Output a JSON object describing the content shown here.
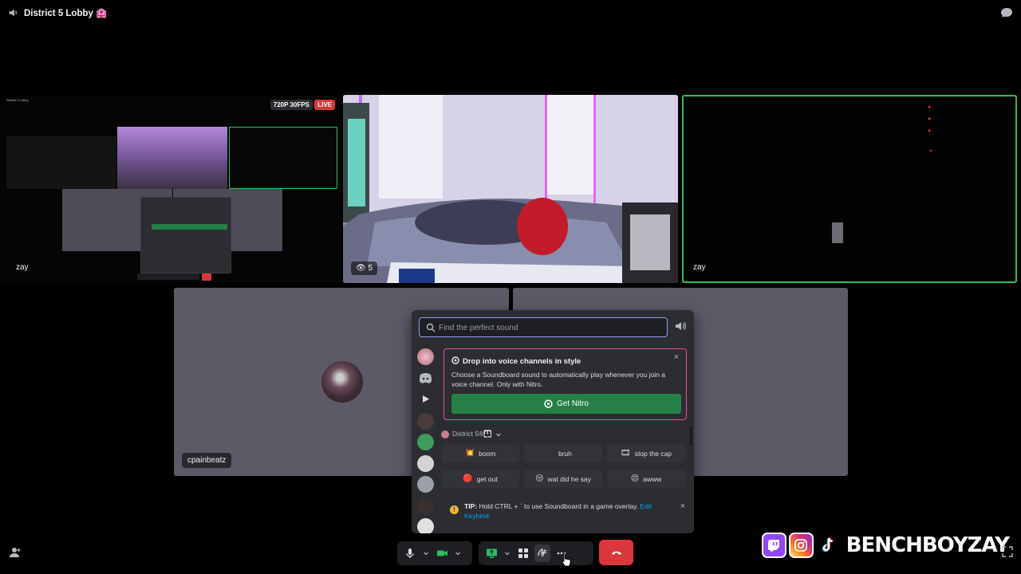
{
  "window": {
    "title": "District 5 Lobby 🏩"
  },
  "tiles": {
    "screenshare": {
      "resolution_badge": "720P 30FPS",
      "live_badge": "LIVE",
      "mini_title": "District 5 Lobby",
      "user": "zay"
    },
    "camera_main": {
      "viewer_count": "5"
    },
    "camera_dark": {
      "user": "zay"
    },
    "avatar_tile": {
      "user": "cpainbeatz"
    }
  },
  "soundboard": {
    "search_placeholder": "Find the perfect sound",
    "promo": {
      "title": "Drop into voice channels in style",
      "description": "Choose a Soundboard sound to automatically play whenever you join a voice channel. Only with Nitro.",
      "button_label": "Get Nitro",
      "close": "×"
    },
    "guild_name": "District 5®👨‍👩‍👦",
    "sounds": [
      {
        "emoji": "💥",
        "label": "boom"
      },
      {
        "emoji": "",
        "label": "bruh"
      },
      {
        "emoji": "🎞",
        "label": "stop the cap"
      },
      {
        "emoji": "🔴",
        "label": "get out"
      },
      {
        "emoji": "😒",
        "label": "wat did he say"
      },
      {
        "emoji": "😣",
        "label": "awww"
      }
    ],
    "tip": {
      "prefix": "TIP:",
      "text": "Hold CTRL + ` to use Soundboard in a game overlay.",
      "link": "Edit Keybind.",
      "close": "×"
    }
  },
  "overlay": {
    "handle": "BENCHBOYZAY"
  },
  "colors": {
    "speaking": "#2dbe62",
    "nitro_border": "#e94ca0",
    "nitro_button": "#248046",
    "hangup": "#da373c",
    "search_focus": "#949cf7"
  }
}
